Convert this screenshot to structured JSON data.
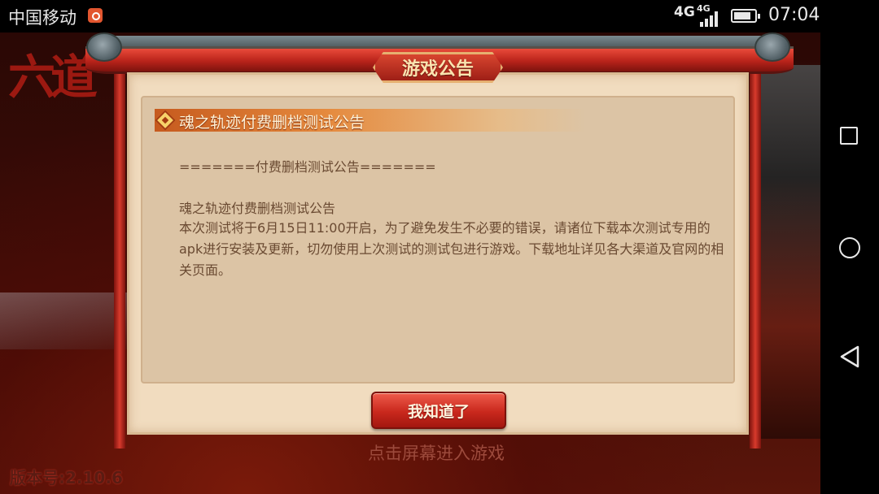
{
  "status_bar": {
    "carrier": "中国移动",
    "network_primary": "4G",
    "network_secondary": "4G",
    "time": "07:04",
    "icons": [
      "notification-icon",
      "signal-icon",
      "battery-icon"
    ]
  },
  "game": {
    "version_label": "版本号:2.10.6",
    "tap_hint": "点击屏幕进入游戏"
  },
  "dialog": {
    "title": "游戏公告",
    "heading": "魂之轨迹付费删档测试公告",
    "separator_line": "=======付费删档测试公告=======",
    "notice_title": "魂之轨迹付费删档测试公告",
    "notice_body": "本次测试将于6月15日11:00开启，为了避免发生不必要的错误，请诸位下载本次测试专用的apk进行安装及更新，切勿使用上次测试的测试包进行游戏。下载地址详见各大渠道及官网的相关页面。",
    "confirm_label": "我知道了"
  },
  "colors": {
    "accent_red": "#c9281d",
    "panel_bg": "#f1dcbf",
    "text_brown": "#6a4a32"
  },
  "nav_bar": {
    "buttons": [
      "recents-icon",
      "home-icon",
      "back-icon"
    ]
  }
}
